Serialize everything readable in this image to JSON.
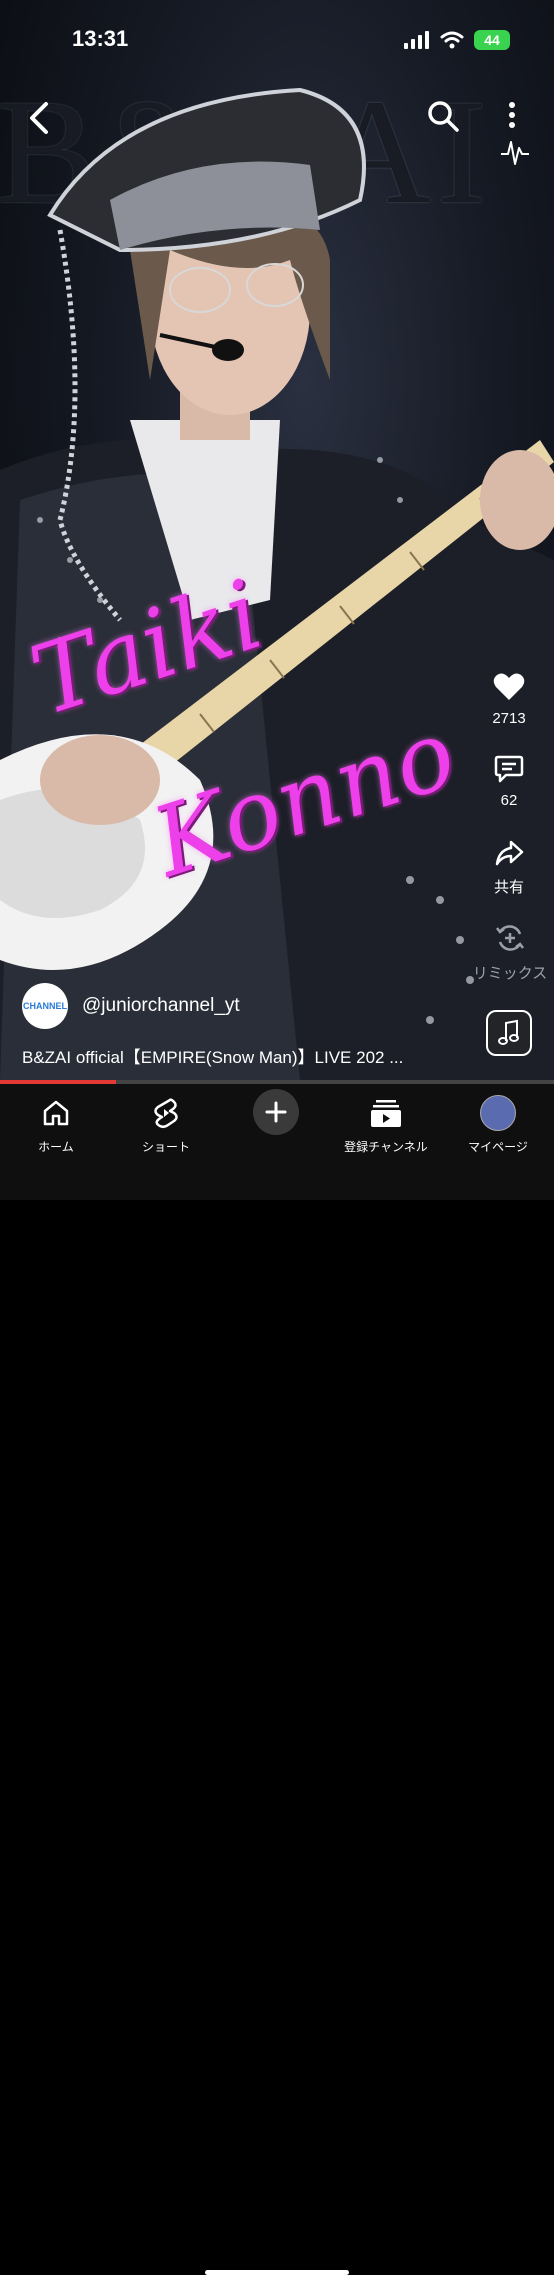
{
  "status": {
    "time": "13:31",
    "battery": "44"
  },
  "video": {
    "background_title": "B&ZAI",
    "overlay_first": "Taiki",
    "overlay_last": "Konno",
    "overlay_color": "#ee40ea"
  },
  "top": {
    "back_icon": "chevron-left-icon",
    "search_icon": "search-icon",
    "more_icon": "more-vertical-icon"
  },
  "actions": {
    "like_count": "2713",
    "comment_count": "62",
    "share_label": "共有",
    "remix_label": "リミックス"
  },
  "channel": {
    "avatar_text": "CHANNEL",
    "handle": "@juniorchannel_yt"
  },
  "caption": "B&ZAI official【EMPIRE(Snow Man)】LIVE 202 ...",
  "progress": 0.21,
  "nav": {
    "home": "ホーム",
    "shorts": "ショート",
    "subscriptions": "登録チャンネル",
    "you": "マイページ"
  },
  "colors": {
    "accent": "#e53935",
    "nav_bg": "#0f0f0f"
  }
}
